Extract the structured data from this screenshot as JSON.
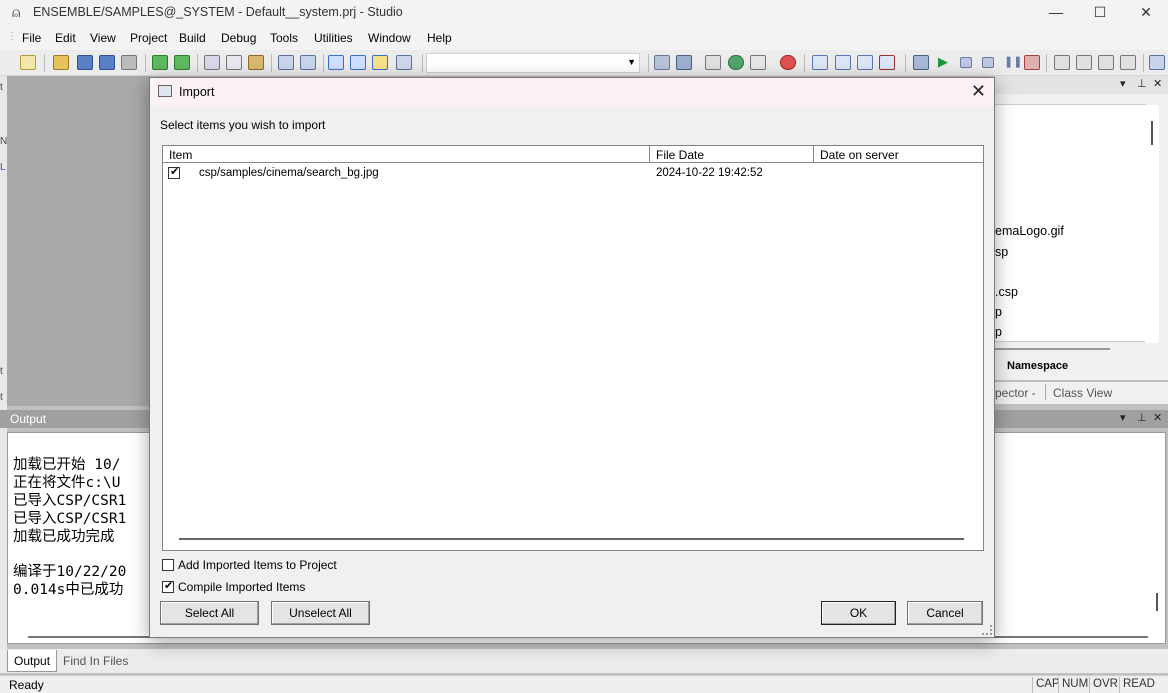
{
  "window": {
    "title": "ENSEMBLE/SAMPLES@_SYSTEM - Default__system.prj - Studio",
    "app_icon": "compass-icon",
    "minimize": "—",
    "maximize": "☐",
    "close": "✕"
  },
  "menu": [
    "File",
    "Edit",
    "View",
    "Project",
    "Build",
    "Debug",
    "Tools",
    "Utilities",
    "Window",
    "Help"
  ],
  "right_panel": {
    "tree_items": [
      "emaLogo.gif",
      "sp",
      ".csp",
      "p",
      "p"
    ],
    "tab_namespace": "Namespace",
    "bottom_tabs": [
      "pector -",
      "Class View"
    ]
  },
  "output": {
    "title": "Output",
    "lines": [
      "加载已开始 10/",
      "正在将文件c:\\U",
      "已导入CSP/CSR1",
      "已导入CSP/CSR1",
      "加载已成功完成",
      "",
      "编译于10/22/20",
      "0.014s中已成功"
    ],
    "tabs": [
      "Output",
      "Find In Files"
    ]
  },
  "status": {
    "ready": "Ready",
    "indicators": [
      "CAP",
      "NUM",
      "OVR",
      "READ"
    ]
  },
  "dialog": {
    "title": "Import",
    "close": "✕",
    "prompt": "Select items you wish to import",
    "columns": [
      "Item",
      "File Date",
      "Date on server"
    ],
    "rows": [
      {
        "checked": true,
        "item": "csp/samples/cinema/search_bg.jpg",
        "file_date": "2024-10-22 19:42:52",
        "server_date": ""
      }
    ],
    "add_to_project": {
      "label": "Add Imported Items to Project",
      "checked": false
    },
    "compile": {
      "label": "Compile Imported Items",
      "checked": true
    },
    "buttons": {
      "select_all": "Select All",
      "unselect_all": "Unselect All",
      "ok": "OK",
      "cancel": "Cancel"
    }
  },
  "colors": {
    "dialog_title_bg": "#fbf1f4",
    "editor_bg": "#a9a9a9",
    "output_header_bg": "#a0a0a0"
  }
}
